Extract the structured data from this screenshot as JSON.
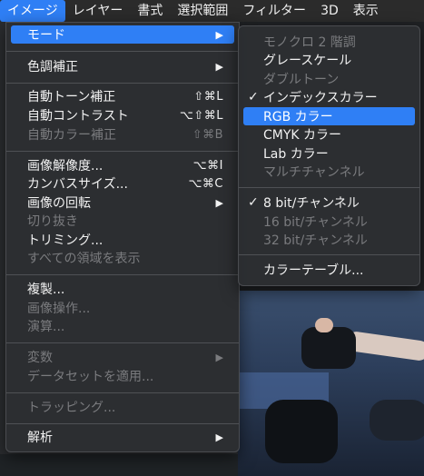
{
  "menubar": {
    "items": [
      "イメージ",
      "レイヤー",
      "書式",
      "選択範囲",
      "フィルター",
      "3D",
      "表示"
    ],
    "active_index": 0
  },
  "image_menu": {
    "mode": "モード",
    "color_adjust": "色調補正",
    "auto_tone": "自動トーン補正",
    "auto_tone_sc": "⇧⌘L",
    "auto_contrast": "自動コントラスト",
    "auto_contrast_sc": "⌥⇧⌘L",
    "auto_color": "自動カラー補正",
    "auto_color_sc": "⇧⌘B",
    "image_size": "画像解像度...",
    "image_size_sc": "⌥⌘I",
    "canvas_size": "カンバスサイズ...",
    "canvas_size_sc": "⌥⌘C",
    "rotation": "画像の回転",
    "crop": "切り抜き",
    "trim": "トリミング...",
    "reveal_all": "すべての領域を表示",
    "duplicate": "複製...",
    "apply_image": "画像操作...",
    "calculations": "演算...",
    "variables": "変数",
    "apply_dataset": "データセットを適用...",
    "trapping": "トラッピング...",
    "analysis": "解析",
    "submenu_arrow": "▶"
  },
  "mode_menu": {
    "items": [
      {
        "label": "モノクロ 2 階調",
        "enabled": false,
        "checked": false
      },
      {
        "label": "グレースケール",
        "enabled": true,
        "checked": false
      },
      {
        "label": "ダブルトーン",
        "enabled": false,
        "checked": false
      },
      {
        "label": "インデックスカラー",
        "enabled": true,
        "checked": true
      },
      {
        "label": "RGB カラー",
        "enabled": true,
        "checked": false,
        "highlighted": true
      },
      {
        "label": "CMYK カラー",
        "enabled": true,
        "checked": false
      },
      {
        "label": "Lab カラー",
        "enabled": true,
        "checked": false
      },
      {
        "label": "マルチチャンネル",
        "enabled": false,
        "checked": false
      },
      {
        "label": "8 bit/チャンネル",
        "enabled": true,
        "checked": true
      },
      {
        "label": "16 bit/チャンネル",
        "enabled": false,
        "checked": false
      },
      {
        "label": "32 bit/チャンネル",
        "enabled": false,
        "checked": false
      },
      {
        "label": "カラーテーブル...",
        "enabled": true,
        "checked": false
      }
    ],
    "checkmark": "✓"
  },
  "colors": {
    "highlight": "#2f7ff5",
    "disabled_text": "#7a7b7e",
    "menu_bg": "#2c2e32"
  }
}
